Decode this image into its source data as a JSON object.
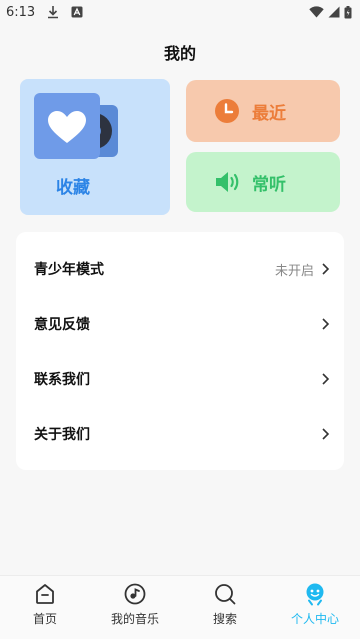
{
  "status_bar": {
    "time": "6:13"
  },
  "page": {
    "title": "我的"
  },
  "cards": {
    "favorites": {
      "label": "收藏"
    },
    "recent": {
      "label": "最近"
    },
    "often": {
      "label": "常听"
    }
  },
  "menu": [
    {
      "label": "青少年模式",
      "status": "未开启"
    },
    {
      "label": "意见反馈",
      "status": ""
    },
    {
      "label": "联系我们",
      "status": ""
    },
    {
      "label": "关于我们",
      "status": ""
    }
  ],
  "tabs": [
    {
      "label": "首页",
      "icon": "home-icon"
    },
    {
      "label": "我的音乐",
      "icon": "music-icon"
    },
    {
      "label": "搜索",
      "icon": "search-icon"
    },
    {
      "label": "个人中心",
      "icon": "profile-icon",
      "active": true
    }
  ],
  "colors": {
    "accent": "#1fb9f0",
    "favorites_bg": "#c8e1fb",
    "recent_bg": "#f7c9ad",
    "often_bg": "#c4f3cc"
  }
}
